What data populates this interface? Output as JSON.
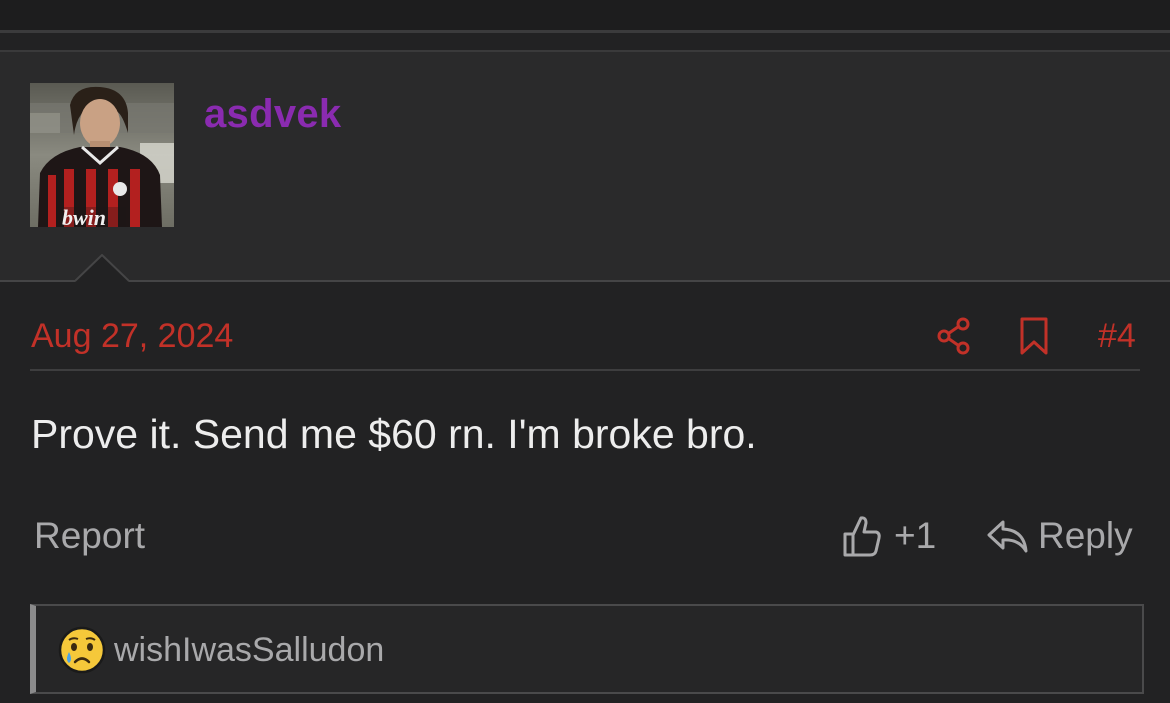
{
  "post": {
    "username": "asdvek",
    "date": "Aug 27, 2024",
    "number": "#4",
    "body": "Prove it. Send me $60 rn. I'm broke bro.",
    "avatar_jersey_text": "bwin"
  },
  "actions": {
    "report_label": "Report",
    "like_count": "+1",
    "reply_label": "Reply"
  },
  "reactions": {
    "users": "wishIwasSalludon",
    "emoji": "crying-face-icon"
  },
  "colors": {
    "username": "#8a2bb0",
    "accent_red": "#c23128",
    "background": "#222223",
    "header_background": "#2a2a2b"
  }
}
